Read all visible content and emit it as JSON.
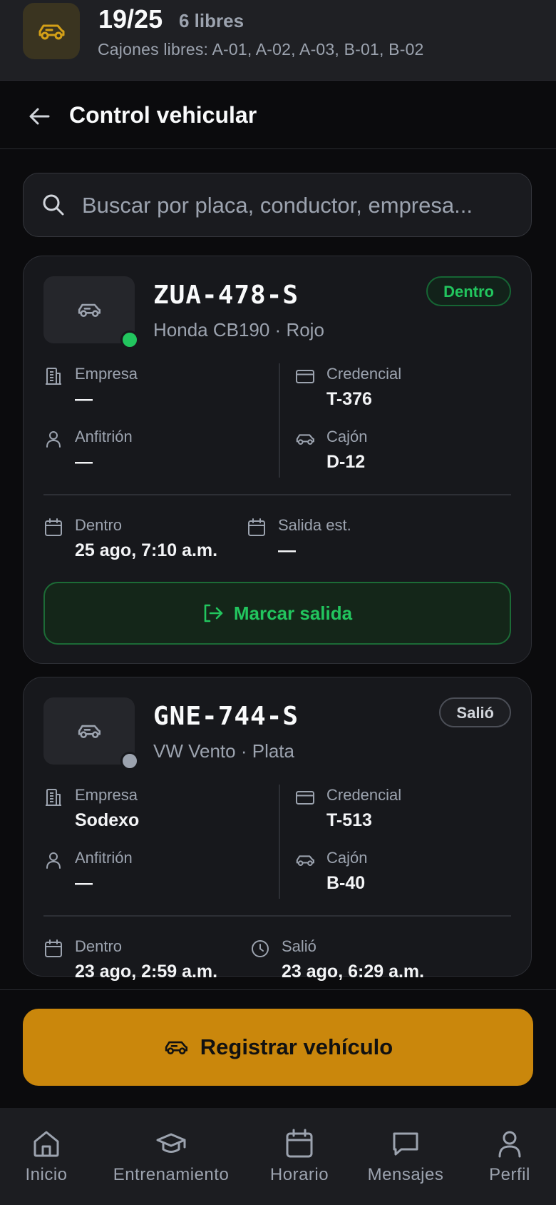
{
  "summary": {
    "icon": "car-icon",
    "count": "19/25",
    "free": "6 libres",
    "free_spots": "Cajones libres: A-01, A-02, A-03, B-01, B-02",
    "accent_color": "#d4a017"
  },
  "header": {
    "back_icon": "arrow-left-icon",
    "title": "Control vehicular"
  },
  "search": {
    "placeholder": "Buscar por placa, conductor, empresa..."
  },
  "vehicles": [
    {
      "plate": "ZUA-478-S",
      "model": "Honda CB190 · Rojo",
      "status": "Dentro",
      "status_color": "#22c55e",
      "company_label": "Empresa",
      "company": "—",
      "host_label": "Anfitrión",
      "host": "—",
      "credential_label": "Credencial",
      "credential": "T-376",
      "spot_label": "Cajón",
      "spot": "D-12",
      "in_label": "Dentro",
      "in_time": "25 ago, 7:10 a.m.",
      "out_label": "Salida est.",
      "out_time": "—",
      "action": "Marcar salida"
    },
    {
      "plate": "GNE-744-S",
      "model": "VW Vento · Plata",
      "status": "Salió",
      "status_color": "#9ca3af",
      "company_label": "Empresa",
      "company": "Sodexo",
      "host_label": "Anfitrión",
      "host": "—",
      "credential_label": "Credencial",
      "credential": "T-513",
      "spot_label": "Cajón",
      "spot": "B-40",
      "in_label": "Dentro",
      "in_time": "23 ago, 2:59 a.m.",
      "out_label": "Salió",
      "out_time": "23 ago, 6:29 a.m."
    }
  ],
  "register_button": "Registrar vehículo",
  "register_color": "#ca870c",
  "tabs": [
    {
      "label": "Inicio",
      "icon": "home-icon"
    },
    {
      "label": "Entrenamiento",
      "icon": "graduation-cap-icon"
    },
    {
      "label": "Horario",
      "icon": "calendar-icon"
    },
    {
      "label": "Mensajes",
      "icon": "message-icon"
    },
    {
      "label": "Perfil",
      "icon": "user-icon"
    }
  ]
}
